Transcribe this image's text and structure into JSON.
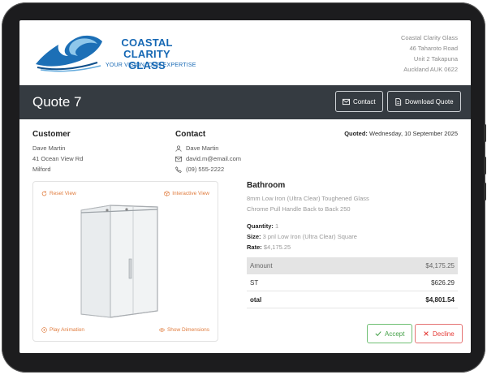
{
  "company": {
    "name_line1": "COASTAL CLARITY",
    "name_line2": "GLASS",
    "tagline": "YOUR VISION, OUR EXPERTISE",
    "address": [
      "Coastal Clarity Glass",
      "46 Taharoto Road",
      "Unit 2 Takapuna",
      "Auckland AUK 0622"
    ],
    "brand_color": "#1668b4"
  },
  "header": {
    "title": "Quote 7",
    "contact_button": "Contact",
    "download_button": "Download Quote",
    "bar_color": "#353b41"
  },
  "customer": {
    "heading": "Customer",
    "name": "Dave Martin",
    "street": "41 Ocean View Rd",
    "suburb": "Milford"
  },
  "contact": {
    "heading": "Contact",
    "name": "Dave Martin",
    "email": "david.m@email.com",
    "phone": "(09) 555-2222"
  },
  "quoted": {
    "label": "Quoted:",
    "date": "Wednesday, 10 September 2025"
  },
  "viewer": {
    "reset": "Reset View",
    "interactive": "Interactive View",
    "play": "Play Animation",
    "dimensions": "Show Dimensions",
    "accent": "#e07b3c"
  },
  "product": {
    "title": "Bathroom",
    "desc1": "8mm Low Iron (Ultra Clear) Toughened Glass",
    "desc2": "Chrome Pull Handle Back to Back 250",
    "quantity_label": "Quantity:",
    "quantity": "1",
    "size_label": "Size:",
    "size": "3 pnl Low Iron (Ultra Clear) Square",
    "rate_label": "Rate:",
    "rate": "$4,175.25"
  },
  "totals": {
    "amount_label": "Amount",
    "amount": "$4,175.25",
    "gst_label": "ST",
    "gst": "$626.29",
    "total_label": "otal",
    "total": "$4,801.54"
  },
  "actions": {
    "accept": "Accept",
    "decline": "Decline",
    "accept_color": "#43a047",
    "decline_color": "#e53935"
  }
}
